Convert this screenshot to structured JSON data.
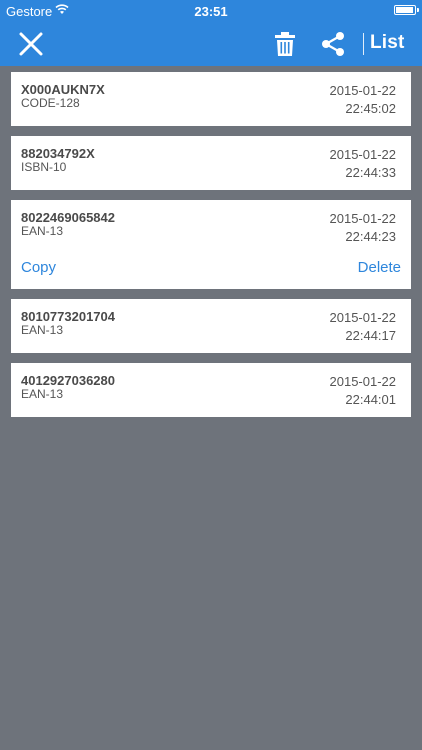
{
  "status_bar": {
    "carrier": "Gestore",
    "time": "23:51"
  },
  "nav": {
    "list_label": "List",
    "icons": [
      "close-icon",
      "trash-icon",
      "share-icon"
    ],
    "color": "#2e86dc"
  },
  "scans": [
    {
      "code": "X000AUKN7X",
      "type": "CODE-128",
      "date": "2015-01-22",
      "time": "22:45:02"
    },
    {
      "code": "882034792X",
      "type": "ISBN-10",
      "date": "2015-01-22",
      "time": "22:44:33"
    },
    {
      "code": "8022469065842",
      "type": "EAN-13",
      "date": "2015-01-22",
      "time": "22:44:23",
      "copy_label": "Copy",
      "delete_label": "Delete"
    },
    {
      "code": "8010773201704",
      "type": "EAN-13",
      "date": "2015-01-22",
      "time": "22:44:17"
    },
    {
      "code": "4012927036280",
      "type": "EAN-13",
      "date": "2015-01-22",
      "time": "22:44:01"
    }
  ],
  "colors": {
    "accent": "#2e86dc",
    "background": "#6e737b",
    "card": "#ffffff"
  }
}
